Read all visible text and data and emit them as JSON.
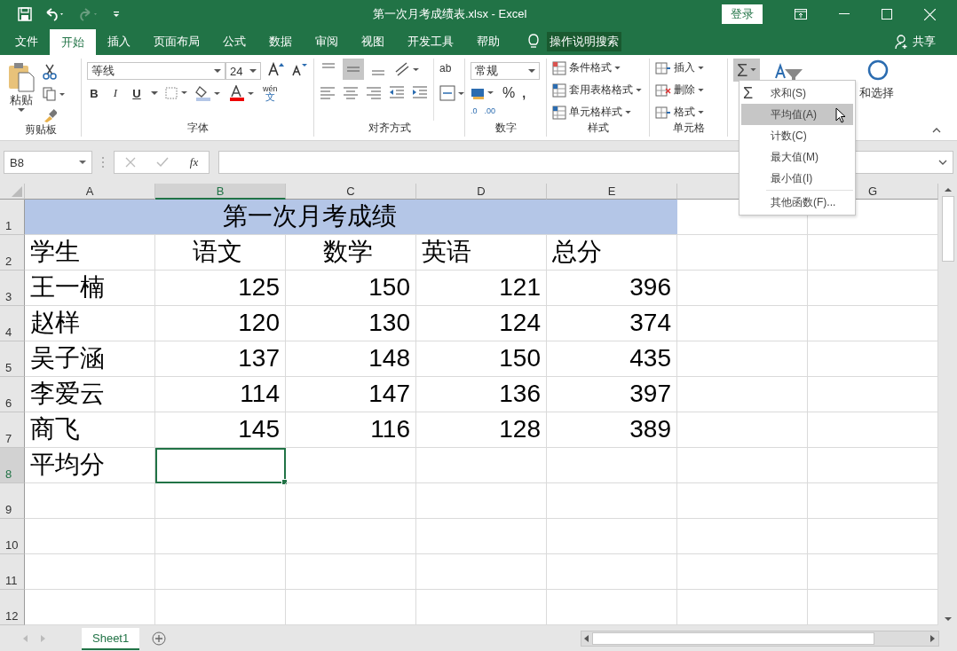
{
  "window": {
    "title": "第一次月考成绩表.xlsx  -  Excel",
    "login_button": "登录"
  },
  "menu_tabs": [
    {
      "label": "文件",
      "selected": false
    },
    {
      "label": "开始",
      "selected": true
    },
    {
      "label": "插入",
      "selected": false
    },
    {
      "label": "页面布局",
      "selected": false
    },
    {
      "label": "公式",
      "selected": false
    },
    {
      "label": "数据",
      "selected": false
    },
    {
      "label": "审阅",
      "selected": false
    },
    {
      "label": "视图",
      "selected": false
    },
    {
      "label": "开发工具",
      "selected": false
    },
    {
      "label": "帮助",
      "selected": false
    }
  ],
  "tell_me": "操作说明搜索",
  "share": "共享",
  "ribbon": {
    "paste": "粘贴",
    "font_name": "等线",
    "font_size": "24",
    "phonetic": "wén",
    "phonetic_char": "文",
    "wrap_glyph": "ab",
    "number_format": "常规",
    "percent": "%",
    "comma": ",",
    "decimal_increase": ".00",
    "decimal_decrease": ".0",
    "styles": [
      "条件格式",
      "套用表格格式",
      "单元格样式"
    ],
    "cell_commands": [
      "插入",
      "删除",
      "格式"
    ],
    "sum_glyph": "Σ",
    "find_select": "和选择",
    "bold": "B",
    "italic": "I",
    "underline": "U",
    "menu_sigma": "Σ",
    "groups": [
      "剪贴板",
      "字体",
      "对齐方式",
      "数字",
      "样式",
      "单元格"
    ]
  },
  "formula_bar": {
    "name_box": "B8",
    "fx": "fx"
  },
  "columns": [
    {
      "label": "A",
      "selected": false
    },
    {
      "label": "B",
      "selected": true
    },
    {
      "label": "C",
      "selected": false
    },
    {
      "label": "D",
      "selected": false
    },
    {
      "label": "E",
      "selected": false
    },
    {
      "label": "G",
      "selected": false
    }
  ],
  "rows": [
    {
      "header": "1",
      "selected": false,
      "cells": [
        {
          "text": "第一次月考成绩",
          "kind": "title",
          "selected": false
        }
      ]
    },
    {
      "header": "2",
      "selected": false,
      "cells": [
        {
          "text": "学生",
          "kind": "text",
          "selected": false
        },
        {
          "text": "语文",
          "kind": "indented",
          "selected": false
        },
        {
          "text": "数学",
          "kind": "indented",
          "selected": false
        },
        {
          "text": "英语",
          "kind": "text",
          "selected": false
        },
        {
          "text": "总分",
          "kind": "text",
          "selected": false
        }
      ]
    },
    {
      "header": "3",
      "selected": false,
      "cells": [
        {
          "text": "王一楠",
          "kind": "text",
          "selected": false
        },
        {
          "text": "125",
          "kind": "number",
          "selected": false
        },
        {
          "text": "150",
          "kind": "number",
          "selected": false
        },
        {
          "text": "121",
          "kind": "number",
          "selected": false
        },
        {
          "text": "396",
          "kind": "number",
          "selected": false
        }
      ]
    },
    {
      "header": "4",
      "selected": false,
      "cells": [
        {
          "text": "赵样",
          "kind": "text",
          "selected": false
        },
        {
          "text": "120",
          "kind": "number",
          "selected": false
        },
        {
          "text": "130",
          "kind": "number",
          "selected": false
        },
        {
          "text": "124",
          "kind": "number",
          "selected": false
        },
        {
          "text": "374",
          "kind": "number",
          "selected": false
        }
      ]
    },
    {
      "header": "5",
      "selected": false,
      "cells": [
        {
          "text": "吴子涵",
          "kind": "text",
          "selected": false
        },
        {
          "text": "137",
          "kind": "number",
          "selected": false
        },
        {
          "text": "148",
          "kind": "number",
          "selected": false
        },
        {
          "text": "150",
          "kind": "number",
          "selected": false
        },
        {
          "text": "435",
          "kind": "number",
          "selected": false
        }
      ]
    },
    {
      "header": "6",
      "selected": false,
      "cells": [
        {
          "text": "李爱云",
          "kind": "text",
          "selected": false
        },
        {
          "text": "114",
          "kind": "number",
          "selected": false
        },
        {
          "text": "147",
          "kind": "number",
          "selected": false
        },
        {
          "text": "136",
          "kind": "number",
          "selected": false
        },
        {
          "text": "397",
          "kind": "number",
          "selected": false
        }
      ]
    },
    {
      "header": "7",
      "selected": false,
      "cells": [
        {
          "text": "商飞",
          "kind": "text",
          "selected": false
        },
        {
          "text": "145",
          "kind": "number",
          "selected": false
        },
        {
          "text": "116",
          "kind": "number",
          "selected": false
        },
        {
          "text": "128",
          "kind": "number",
          "selected": false
        },
        {
          "text": "389",
          "kind": "number",
          "selected": false
        }
      ]
    },
    {
      "header": "8",
      "selected": true,
      "cells": [
        {
          "text": "平均分",
          "kind": "text",
          "selected": false
        },
        {
          "text": "",
          "kind": "text",
          "selected": true
        }
      ]
    },
    {
      "header": "9",
      "selected": false,
      "cells": []
    },
    {
      "header": "10",
      "selected": false,
      "cells": []
    },
    {
      "header": "11",
      "selected": false,
      "cells": []
    },
    {
      "header": "12",
      "selected": false,
      "cells": []
    }
  ],
  "autosum_menu": [
    {
      "label": "求和(S)",
      "selected": false,
      "separator_before": false
    },
    {
      "label": "平均值(A)",
      "selected": true,
      "separator_before": false
    },
    {
      "label": "计数(C)",
      "selected": false,
      "separator_before": false
    },
    {
      "label": "最大值(M)",
      "selected": false,
      "separator_before": false
    },
    {
      "label": "最小值(I)",
      "selected": false,
      "separator_before": false
    },
    {
      "label": "其他函数(F)...",
      "selected": false,
      "separator_before": true
    }
  ],
  "sheet_tabs": [
    {
      "label": "Sheet1",
      "selected": true
    }
  ]
}
